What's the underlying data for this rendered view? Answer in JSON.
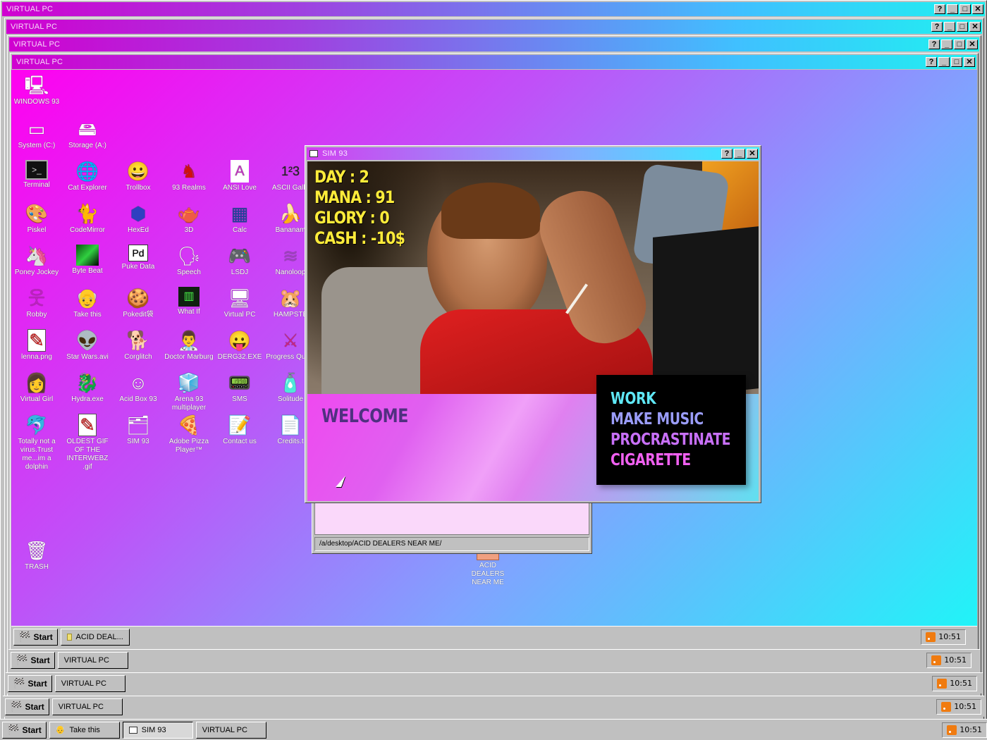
{
  "windows": [
    {
      "title": "VIRTUAL PC"
    },
    {
      "title": "VIRTUAL PC"
    },
    {
      "title": "VIRTUAL PC"
    },
    {
      "title": "VIRTUAL PC"
    }
  ],
  "title_buttons": {
    "help": "?",
    "minimize": "_",
    "maximize": "□",
    "close": "✕"
  },
  "desktop_icons": [
    {
      "label": "WINDOWS 93",
      "icon": "computer-icon"
    },
    {
      "label": "System (C:)",
      "icon": "drive-icon"
    },
    {
      "label": "Storage (A:)",
      "icon": "floppy-drive-icon"
    },
    {
      "label": "Terminal",
      "icon": "terminal-icon"
    },
    {
      "label": "Cat Explorer",
      "icon": "globe-cat-icon"
    },
    {
      "label": "Trollbox",
      "icon": "chat-face-icon"
    },
    {
      "label": "93 Realms",
      "icon": "knight-icon"
    },
    {
      "label": "ANSI Love",
      "icon": "ansi-icon"
    },
    {
      "label": "ASCII Galle",
      "icon": "numbers-icon"
    },
    {
      "label": "Piskel",
      "icon": "palette-icon"
    },
    {
      "label": "CodeMirror",
      "icon": "cat-sketch-icon"
    },
    {
      "label": "HexEd",
      "icon": "hex-cube-icon"
    },
    {
      "label": "3D",
      "icon": "teapot-icon"
    },
    {
      "label": "Calc",
      "icon": "calculator-icon"
    },
    {
      "label": "Bananam",
      "icon": "banana-icon"
    },
    {
      "label": "Poney Jockey",
      "icon": "pony-icon"
    },
    {
      "label": "Byte Beat",
      "icon": "bytebeat-icon"
    },
    {
      "label": "Puke Data",
      "icon": "puke-data-icon"
    },
    {
      "label": "Speech",
      "icon": "speech-face-icon"
    },
    {
      "label": "LSDJ",
      "icon": "gameboy-icon"
    },
    {
      "label": "Nanoloop",
      "icon": "nanoloop-icon"
    },
    {
      "label": "Robby",
      "icon": "stick-figure-icon"
    },
    {
      "label": "Take this",
      "icon": "pixel-man-icon"
    },
    {
      "label": "Pokedit袋",
      "icon": "pokeball-icon"
    },
    {
      "label": "What If",
      "icon": "matrix-icon"
    },
    {
      "label": "Virtual PC",
      "icon": "virtual-pc-icon"
    },
    {
      "label": "HAMPSTE",
      "icon": "hamster-icon"
    },
    {
      "label": "lenna.png",
      "icon": "image-file-icon"
    },
    {
      "label": "Star Wars.avi",
      "icon": "yoda-icon"
    },
    {
      "label": "Corglitch",
      "icon": "corgi-icon"
    },
    {
      "label": "Doctor Marburg",
      "icon": "doctor-icon"
    },
    {
      "label": "DERG32.EXE",
      "icon": "monitor-face-icon"
    },
    {
      "label": "Progress Quest",
      "icon": "crossed-swords-icon"
    },
    {
      "label": "Virtual Girl",
      "icon": "girl-face-icon"
    },
    {
      "label": "Hydra.exe",
      "icon": "hydra-icon"
    },
    {
      "label": "Acid Box 93",
      "icon": "smiley-icon"
    },
    {
      "label": "Arena 93 multiplayer",
      "icon": "cube-icon"
    },
    {
      "label": "SMS",
      "icon": "phone-icon"
    },
    {
      "label": "Solitude",
      "icon": "bottle-icon"
    },
    {
      "label": "Totally not a virus.Trust me...im a dolphin",
      "icon": "dolphin-icon"
    },
    {
      "label": "OLDEST GIF OF THE INTERWEBZ .gif",
      "icon": "gif-file-icon"
    },
    {
      "label": "SIM 93",
      "icon": "sim-icon"
    },
    {
      "label": "Adobe Pizza Player™",
      "icon": "pizza-icon"
    },
    {
      "label": "Contact us",
      "icon": "contact-icon"
    },
    {
      "label": "Credits.t",
      "icon": "text-file-icon"
    },
    {
      "label": "TRASH",
      "icon": "trash-icon"
    },
    {
      "label": "ACID DEALERS NEAR ME",
      "icon": "folder-icon"
    }
  ],
  "explorer": {
    "path": "/a/desktop/ACID DEALERS NEAR ME/"
  },
  "sim93": {
    "title": "SIM 93",
    "stats": {
      "day": "DAY : 2",
      "mana": "MANA : 91",
      "glory": "GLORY : 0",
      "cash": "CASH : -10$"
    },
    "welcome": "WELCOME",
    "menu": [
      {
        "label": "WORK",
        "color": "#5fe8f6"
      },
      {
        "label": "MAKE MUSIC",
        "color": "#9a9cf8"
      },
      {
        "label": "PROCRASTINATE",
        "color": "#c870f8"
      },
      {
        "label": "CIGARETTE",
        "color": "#f060f0"
      }
    ]
  },
  "taskbars": [
    {
      "start": "Start",
      "tasks": [
        {
          "label": "ACID DEAL..."
        }
      ],
      "clock": "10:51"
    },
    {
      "start": "Start",
      "tasks": [
        {
          "label": "VIRTUAL PC"
        }
      ],
      "clock": "10:51"
    },
    {
      "start": "Start",
      "tasks": [
        {
          "label": "VIRTUAL PC"
        }
      ],
      "clock": "10:51"
    },
    {
      "start": "Start",
      "tasks": [
        {
          "label": "VIRTUAL PC"
        }
      ],
      "clock": "10:51"
    },
    {
      "start": "Start",
      "tasks": [
        {
          "label": "Take this"
        },
        {
          "label": "SIM 93"
        },
        {
          "label": "VIRTUAL PC"
        }
      ],
      "clock": "10:51"
    }
  ]
}
